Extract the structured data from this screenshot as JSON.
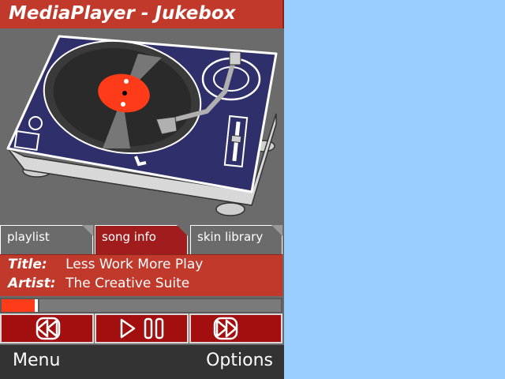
{
  "app": {
    "title": "MediaPlayer - Jukebox"
  },
  "tabs": [
    {
      "label": "playlist",
      "active": false
    },
    {
      "label": "song info",
      "active": true
    },
    {
      "label": "skin library",
      "active": false
    }
  ],
  "song": {
    "title_label": "Title:",
    "title_value": "Less Work More Play",
    "artist_label": "Artist:",
    "artist_value": "The Creative Suite"
  },
  "progress": {
    "fraction": 0.13
  },
  "controls": {
    "rewind_icon": "rewind-icon",
    "play_pause_icon": "play-pause-icon",
    "fast_forward_icon": "fast-forward-icon"
  },
  "softkeys": {
    "left": "Menu",
    "right": "Options"
  },
  "colors": {
    "brand_red": "#c0392b",
    "active_tab": "#a11d1d",
    "progress_fill": "#ff3b1a",
    "backdrop": "#99ccff",
    "turntable_blue": "#2f2f6b",
    "record_label": "#ff3b1a"
  }
}
